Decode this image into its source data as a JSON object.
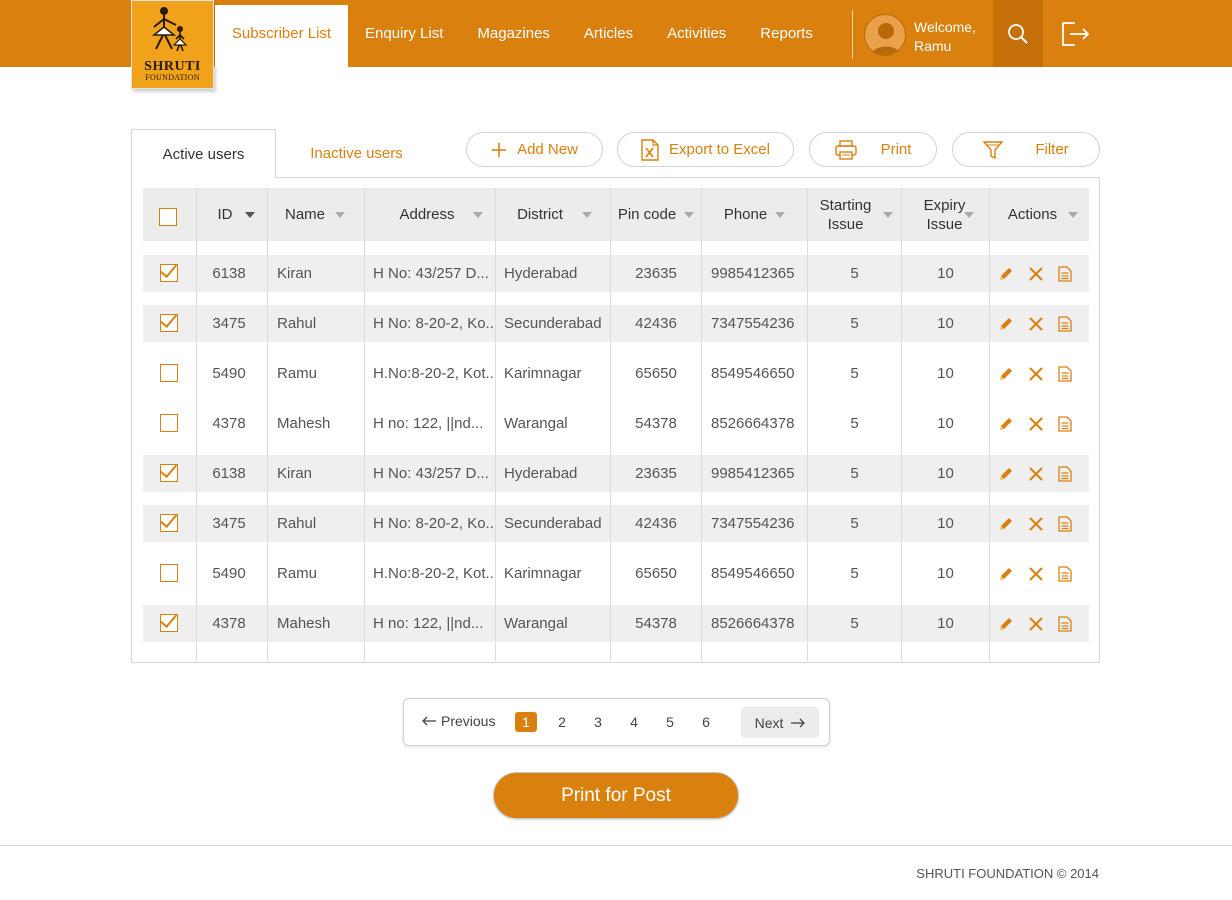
{
  "header": {
    "logo_text": "SHRUTI",
    "logo_subtext": "FOUNDATION",
    "nav": [
      {
        "label": "Subscriber List",
        "active": true
      },
      {
        "label": "Enquiry List",
        "active": false
      },
      {
        "label": "Magazines",
        "active": false
      },
      {
        "label": "Articles",
        "active": false
      },
      {
        "label": "Activities",
        "active": false
      },
      {
        "label": "Reports",
        "active": false
      }
    ],
    "welcome_line1": "Welcome,",
    "welcome_line2": "Ramu",
    "icons": [
      "user-avatar-icon",
      "search-icon",
      "logout-icon"
    ]
  },
  "tabs": {
    "active_label": "Active users",
    "inactive_label": "Inactive users"
  },
  "toolbar": {
    "add_new": "Add New",
    "export": "Export to Excel",
    "print": "Print",
    "filter": "Filter"
  },
  "table": {
    "headers": {
      "id": "ID",
      "name": "Name",
      "address": "Address",
      "district": "District",
      "pincode": "Pin code",
      "phone": "Phone",
      "starting_1": "Starting",
      "starting_2": "Issue",
      "expiry_1": "Expiry",
      "expiry_2": "Issue",
      "actions": "Actions"
    },
    "rows": [
      {
        "checked": true,
        "id": "6138",
        "name": "Kiran",
        "address": "H No: 43/257 D...",
        "district": "Hyderabad",
        "pincode": "23635",
        "phone": "9985412365",
        "start": "5",
        "expiry": "10"
      },
      {
        "checked": true,
        "id": "3475",
        "name": "Rahul",
        "address": "H No: 8-20-2, Ko...",
        "district": "Secunderabad",
        "pincode": "42436",
        "phone": "7347554236",
        "start": "5",
        "expiry": "10"
      },
      {
        "checked": false,
        "id": "5490",
        "name": "Ramu",
        "address": "H.No:8-20-2, Kot...",
        "district": "Karimnagar",
        "pincode": "65650",
        "phone": "8549546650",
        "start": "5",
        "expiry": "10"
      },
      {
        "checked": false,
        "id": "4378",
        "name": "Mahesh",
        "address": "H no: 122, ||nd...",
        "district": "Warangal",
        "pincode": "54378",
        "phone": "8526664378",
        "start": "5",
        "expiry": "10"
      },
      {
        "checked": true,
        "id": "6138",
        "name": "Kiran",
        "address": "H No: 43/257 D...",
        "district": "Hyderabad",
        "pincode": "23635",
        "phone": "9985412365",
        "start": "5",
        "expiry": "10"
      },
      {
        "checked": true,
        "id": "3475",
        "name": "Rahul",
        "address": "H No: 8-20-2, Ko...",
        "district": "Secunderabad",
        "pincode": "42436",
        "phone": "7347554236",
        "start": "5",
        "expiry": "10"
      },
      {
        "checked": false,
        "id": "5490",
        "name": "Ramu",
        "address": "H.No:8-20-2, Kot...",
        "district": "Karimnagar",
        "pincode": "65650",
        "phone": "8549546650",
        "start": "5",
        "expiry": "10"
      },
      {
        "checked": true,
        "id": "4378",
        "name": "Mahesh",
        "address": "H no: 122, ||nd...",
        "district": "Warangal",
        "pincode": "54378",
        "phone": "8526664378",
        "start": "5",
        "expiry": "10"
      }
    ]
  },
  "pagination": {
    "previous": "Previous",
    "next": "Next",
    "pages": [
      "1",
      "2",
      "3",
      "4",
      "5",
      "6"
    ],
    "current": "1"
  },
  "print_for_post": "Print for Post",
  "footer": "SHRUTI FOUNDATION © 2014",
  "colors": {
    "accent": "#d9800f",
    "accent_dark": "#c46f08",
    "row_alt": "#efefef",
    "header_bg": "#ececec"
  }
}
